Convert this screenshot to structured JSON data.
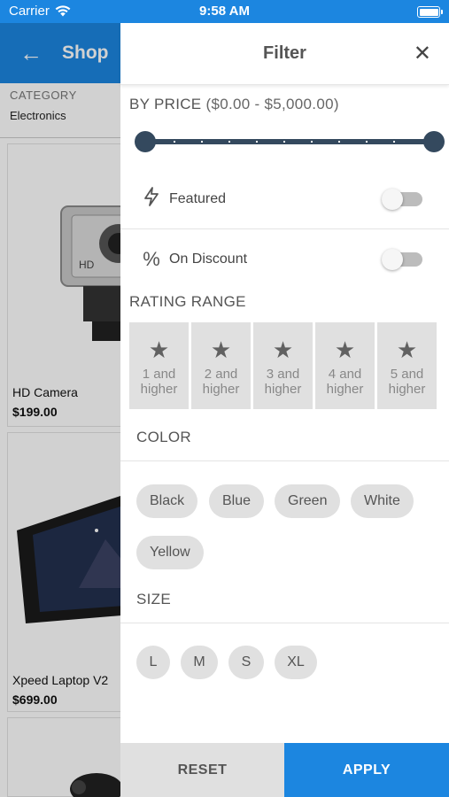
{
  "status": {
    "carrier": "Carrier",
    "time": "9:58 AM"
  },
  "shop": {
    "title": "Shop",
    "category_label": "CATEGORY",
    "category_value": "Electronics",
    "products": [
      {
        "name": "HD Camera",
        "price": "$199.00"
      },
      {
        "name": "Xpeed Laptop  V2",
        "price": "$699.00"
      }
    ]
  },
  "filter": {
    "title": "Filter",
    "price_label": "BY PRICE",
    "price_range": "($0.00 - $5,000.00)",
    "price_min": 0,
    "price_max": 5000,
    "featured_label": "Featured",
    "featured_on": false,
    "discount_label": "On Discount",
    "discount_on": false,
    "rating_label": "RATING RANGE",
    "ratings": [
      {
        "label": "1 and higher"
      },
      {
        "label": "2 and higher"
      },
      {
        "label": "3 and higher"
      },
      {
        "label": "4 and higher"
      },
      {
        "label": "5 and higher"
      }
    ],
    "color_label": "COLOR",
    "colors": [
      "Black",
      "Blue",
      "Green",
      "White",
      "Yellow"
    ],
    "size_label": "SIZE",
    "sizes": [
      "L",
      "M",
      "S",
      "XL"
    ],
    "reset_label": "RESET",
    "apply_label": "APPLY"
  },
  "theme": {
    "accent": "#1c86e0",
    "slider": "#34495e",
    "chip": "#e0e0e0"
  },
  "icons": {
    "back": "arrow-left-icon",
    "close": "close-icon",
    "featured": "lightning-icon",
    "discount": "percent-icon",
    "star": "star-icon"
  }
}
